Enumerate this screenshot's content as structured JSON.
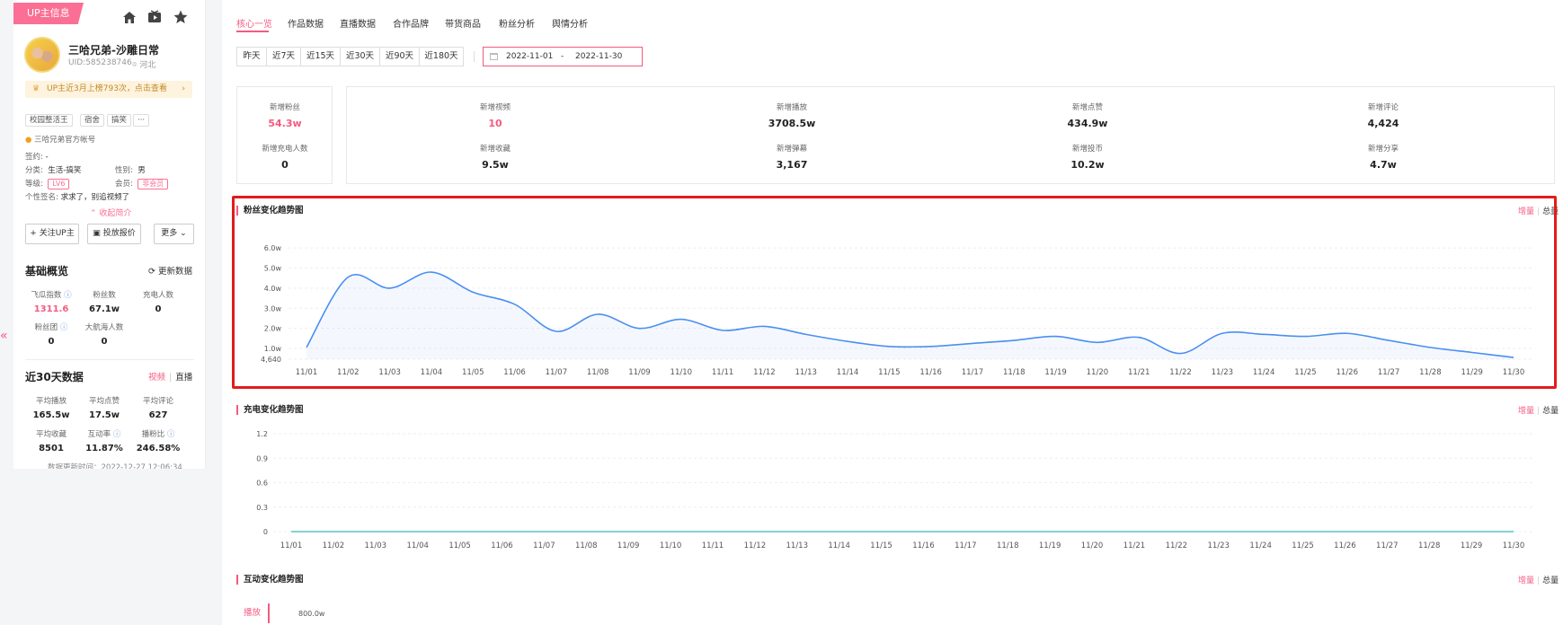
{
  "sidebar": {
    "up_tag": "UP主信息",
    "name": "三哈兄弟-沙雕日常",
    "uid": "UID:585238746",
    "location": "河北",
    "rank_text": "UP主近3月上榜793次，点击查看",
    "tags": [
      "校园整活王",
      "宿舍",
      "搞笑",
      "···"
    ],
    "official": "三哈兄弟官方帐号",
    "sign_label": "签约:",
    "sign_value": "-",
    "category_label": "分类:",
    "category_value": "生活-搞笑",
    "gender_label": "性别:",
    "gender_value": "男",
    "level_label": "等级:",
    "level_value": "LV6",
    "member_label": "会员:",
    "member_value": "非会员",
    "signature_label": "个性签名:",
    "signature_value": "求求了，别追视频了",
    "collapse_label": "收起简介",
    "follow_btn": "关注UP主",
    "report_btn": "投放报价",
    "more_btn": "更多",
    "overview_title": "基础概览",
    "refresh_label": "更新数据",
    "overview": [
      {
        "label": "飞瓜指数",
        "value": "1311.6"
      },
      {
        "label": "粉丝数",
        "value": "67.1w"
      },
      {
        "label": "充电人数",
        "value": "0"
      },
      {
        "label": "粉丝团",
        "value": "0"
      },
      {
        "label": "大航海人数",
        "value": "0"
      }
    ],
    "recent_title": "近30天数据",
    "recent_tab_video": "视频",
    "recent_tab_live": "直播",
    "recent": [
      {
        "label": "平均播放",
        "value": "165.5w"
      },
      {
        "label": "平均点赞",
        "value": "17.5w"
      },
      {
        "label": "平均评论",
        "value": "627"
      },
      {
        "label": "平均收藏",
        "value": "8501"
      },
      {
        "label": "互动率",
        "value": "11.87%"
      },
      {
        "label": "播粉比",
        "value": "246.58%"
      }
    ],
    "update_time": "数据更新时间：2022-12-27 12:06:34"
  },
  "nav": {
    "tabs": [
      "核心一览",
      "作品数据",
      "直播数据",
      "合作品牌",
      "带货商品",
      "粉丝分析",
      "舆情分析"
    ]
  },
  "filters": {
    "ranges": [
      "昨天",
      "近7天",
      "近15天",
      "近30天",
      "近90天",
      "近180天"
    ],
    "date_start": "2022-11-01",
    "date_sep": "-",
    "date_end": "2022-11-30"
  },
  "metrics": {
    "fans": [
      {
        "label": "新增粉丝",
        "value": "54.3w"
      },
      {
        "label": "新增充电人数",
        "value": "0"
      }
    ],
    "grid": [
      {
        "label": "新增视频",
        "value": "10"
      },
      {
        "label": "新增播放",
        "value": "3708.5w"
      },
      {
        "label": "新增点赞",
        "value": "434.9w"
      },
      {
        "label": "新增评论",
        "value": "4,424"
      },
      {
        "label": "新增收藏",
        "value": "9.5w"
      },
      {
        "label": "新增弹幕",
        "value": "3,167"
      },
      {
        "label": "新增投币",
        "value": "10.2w"
      },
      {
        "label": "新增分享",
        "value": "4.7w"
      }
    ]
  },
  "charts": {
    "toggle_on": "增量",
    "toggle_off": "总量",
    "fans_title": "粉丝变化趋势图",
    "charge_title": "充电变化趋势图",
    "interaction_title": "互动变化趋势图",
    "interaction_side_tab": "播放",
    "interaction_top_tick": "800.0w"
  },
  "chart_data": [
    {
      "type": "area",
      "title": "粉丝变化趋势图",
      "y_ticks": [
        "4,640",
        "1.0w",
        "2.0w",
        "3.0w",
        "4.0w",
        "5.0w",
        "6.0w"
      ],
      "ylim": [
        4640,
        65000
      ],
      "x": [
        "11/01",
        "11/02",
        "11/03",
        "11/04",
        "11/05",
        "11/06",
        "11/07",
        "11/08",
        "11/09",
        "11/10",
        "11/11",
        "11/12",
        "11/13",
        "11/14",
        "11/15",
        "11/16",
        "11/17",
        "11/18",
        "11/19",
        "11/20",
        "11/21",
        "11/22",
        "11/23",
        "11/24",
        "11/25",
        "11/26",
        "11/27",
        "11/28",
        "11/29",
        "11/30"
      ],
      "values": [
        10500,
        45500,
        40000,
        48000,
        38000,
        32000,
        18500,
        27000,
        20000,
        24500,
        19000,
        21000,
        17000,
        13500,
        11000,
        11000,
        12500,
        14000,
        16000,
        13000,
        15500,
        7500,
        17500,
        17000,
        16000,
        17500,
        14000,
        10500,
        8000,
        5500
      ],
      "color": "#4a8ff0"
    },
    {
      "type": "line",
      "title": "充电变化趋势图",
      "y_ticks": [
        "0",
        "0.3",
        "0.6",
        "0.9",
        "1.2"
      ],
      "ylim": [
        0,
        1.2
      ],
      "x": [
        "11/01",
        "11/02",
        "11/03",
        "11/04",
        "11/05",
        "11/06",
        "11/07",
        "11/08",
        "11/09",
        "11/10",
        "11/11",
        "11/12",
        "11/13",
        "11/14",
        "11/15",
        "11/16",
        "11/17",
        "11/18",
        "11/19",
        "11/20",
        "11/21",
        "11/22",
        "11/23",
        "11/24",
        "11/25",
        "11/26",
        "11/27",
        "11/28",
        "11/29",
        "11/30"
      ],
      "values": [
        0,
        0,
        0,
        0,
        0,
        0,
        0,
        0,
        0,
        0,
        0,
        0,
        0,
        0,
        0,
        0,
        0,
        0,
        0,
        0,
        0,
        0,
        0,
        0,
        0,
        0,
        0,
        0,
        0,
        0
      ],
      "color": "#3bb3c3"
    }
  ],
  "colors": {
    "accent": "#f45a80",
    "fans_line": "#4a8ff0",
    "highlight": "#e31b1b"
  }
}
